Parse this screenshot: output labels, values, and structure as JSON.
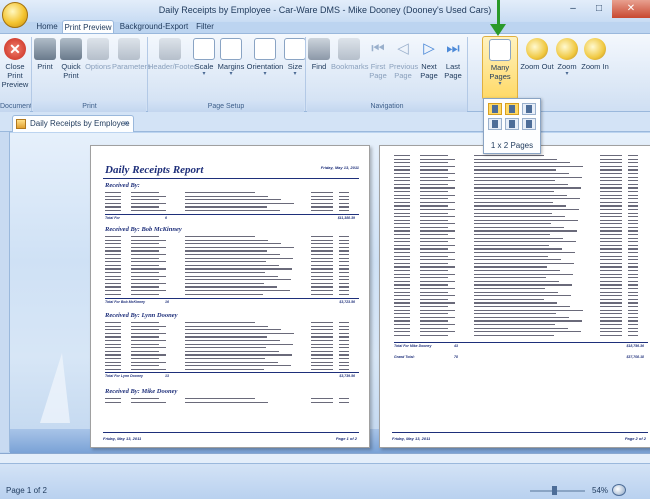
{
  "window": {
    "title": "Daily Receipts by Employee - Car-Ware DMS - Mike Dooney  (Dooney's Used Cars)",
    "minimize": "–",
    "maximize": "□",
    "close": "✕"
  },
  "tabs": [
    {
      "label": "Home"
    },
    {
      "label": "Print Preview"
    },
    {
      "label": "Background-Export"
    },
    {
      "label": "Filter"
    }
  ],
  "ribbon": {
    "groups": {
      "document": "Document",
      "print": "Print",
      "page_setup": "Page Setup",
      "navigation": "Navigation"
    },
    "buttons": {
      "close_print_preview": "Close Print Preview",
      "print": "Print",
      "quick_print": "Quick Print",
      "options": "Options",
      "parameters": "Parameters",
      "header_footer": "Header/Footer",
      "scale": "Scale",
      "margins": "Margins",
      "orientation": "Orientation",
      "size": "Size",
      "find": "Find",
      "bookmarks": "Bookmarks",
      "first_page": "First Page",
      "previous_page": "Previous Page",
      "next_page": "Next Page",
      "last_page": "Last Page",
      "many_pages": "Many Pages",
      "zoom_out": "Zoom Out",
      "zoom": "Zoom",
      "zoom_in": "Zoom In"
    },
    "icons": {
      "close": "close-circle-icon",
      "print": "printer-icon",
      "nav_first": "⏮",
      "nav_prev": "◁",
      "nav_next": "▷",
      "nav_last": "⏭",
      "arrow": "▾"
    }
  },
  "many_pages_dropdown": {
    "label": "1 x 2 Pages"
  },
  "document_tab": {
    "label": "Daily Receipts by Employee",
    "close": "×"
  },
  "report": {
    "title": "Daily Receipts Report",
    "date": "Friday, May 13, 2011",
    "sections": [
      {
        "heading": "Received By:",
        "total_label": "Total For",
        "total_count": "6",
        "total_amount": "$11,388.39"
      },
      {
        "heading": "Received By: Bob McKinney",
        "total_label": "Total For Bob McKinney",
        "total_count": "16",
        "total_amount": "$3,723.56"
      },
      {
        "heading": "Received By: Lynn Dooney",
        "total_label": "Total For Lynn Dooney",
        "total_count": "13",
        "total_amount": "$3,739.56"
      },
      {
        "heading": "Received By: Mike Dooney",
        "total_label": "",
        "total_count": "",
        "total_amount": ""
      }
    ],
    "page2_total_label": "Total For Mike Dooney",
    "page2_total_count": "43",
    "page2_total_amount": "$18,756.36",
    "grand_total_label": "Grand Total:",
    "grand_total_count": "78",
    "grand_total_amount": "$37,708.18",
    "footer_date": "Friday, May 13, 2011",
    "page1_footer": "Page 1 of 2",
    "page2_footer": "Page 2 of 2"
  },
  "status": {
    "page_indicator": "Page 1 of 2",
    "zoom": "54%"
  }
}
